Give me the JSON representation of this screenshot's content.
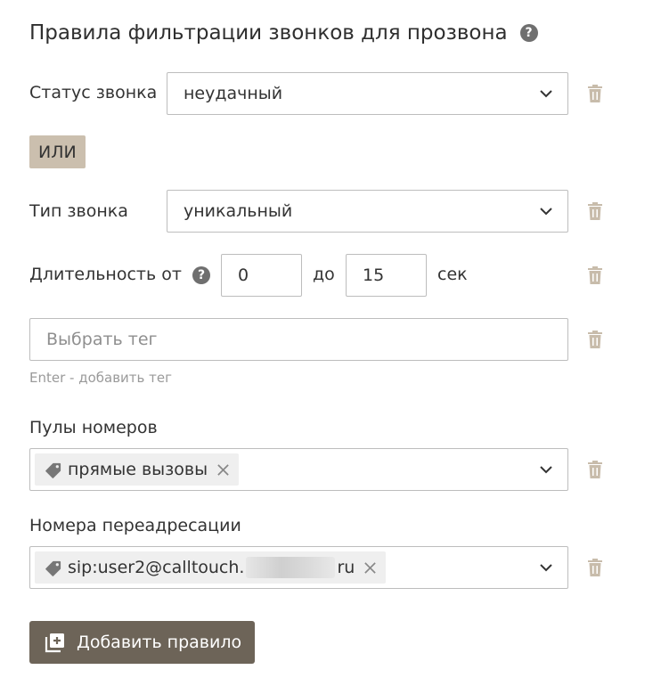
{
  "title": "Правила фильтрации звонков для прозвона",
  "help_glyph": "?",
  "call_status": {
    "label": "Статус звонка",
    "value": "неудачный"
  },
  "or_label": "ИЛИ",
  "call_type": {
    "label": "Тип звонка",
    "value": "уникальный"
  },
  "duration": {
    "label": "Длительность от",
    "from": "0",
    "to_label": "до",
    "to": "15",
    "unit": "сек"
  },
  "tag": {
    "placeholder": "Выбрать тег",
    "hint": "Enter - добавить тег"
  },
  "number_pools": {
    "label": "Пулы номеров",
    "chips": [
      {
        "text": "прямые вызовы"
      }
    ]
  },
  "redirect_numbers": {
    "label": "Номера переадресации",
    "chip_prefix": "sip:user2@calltouch.",
    "chip_suffix": "ru"
  },
  "add_rule_label": "Добавить правило",
  "colors": {
    "accent_button": "#6d6458",
    "or_badge": "#cbbfae",
    "trash": "#c8bcab",
    "border": "#bdbdbd"
  },
  "icons": {
    "help": "question-circle-icon",
    "dropdown": "chevron-down-icon",
    "delete": "trash-icon",
    "tag": "tag-icon",
    "remove": "close-icon",
    "add": "add-box-icon"
  }
}
